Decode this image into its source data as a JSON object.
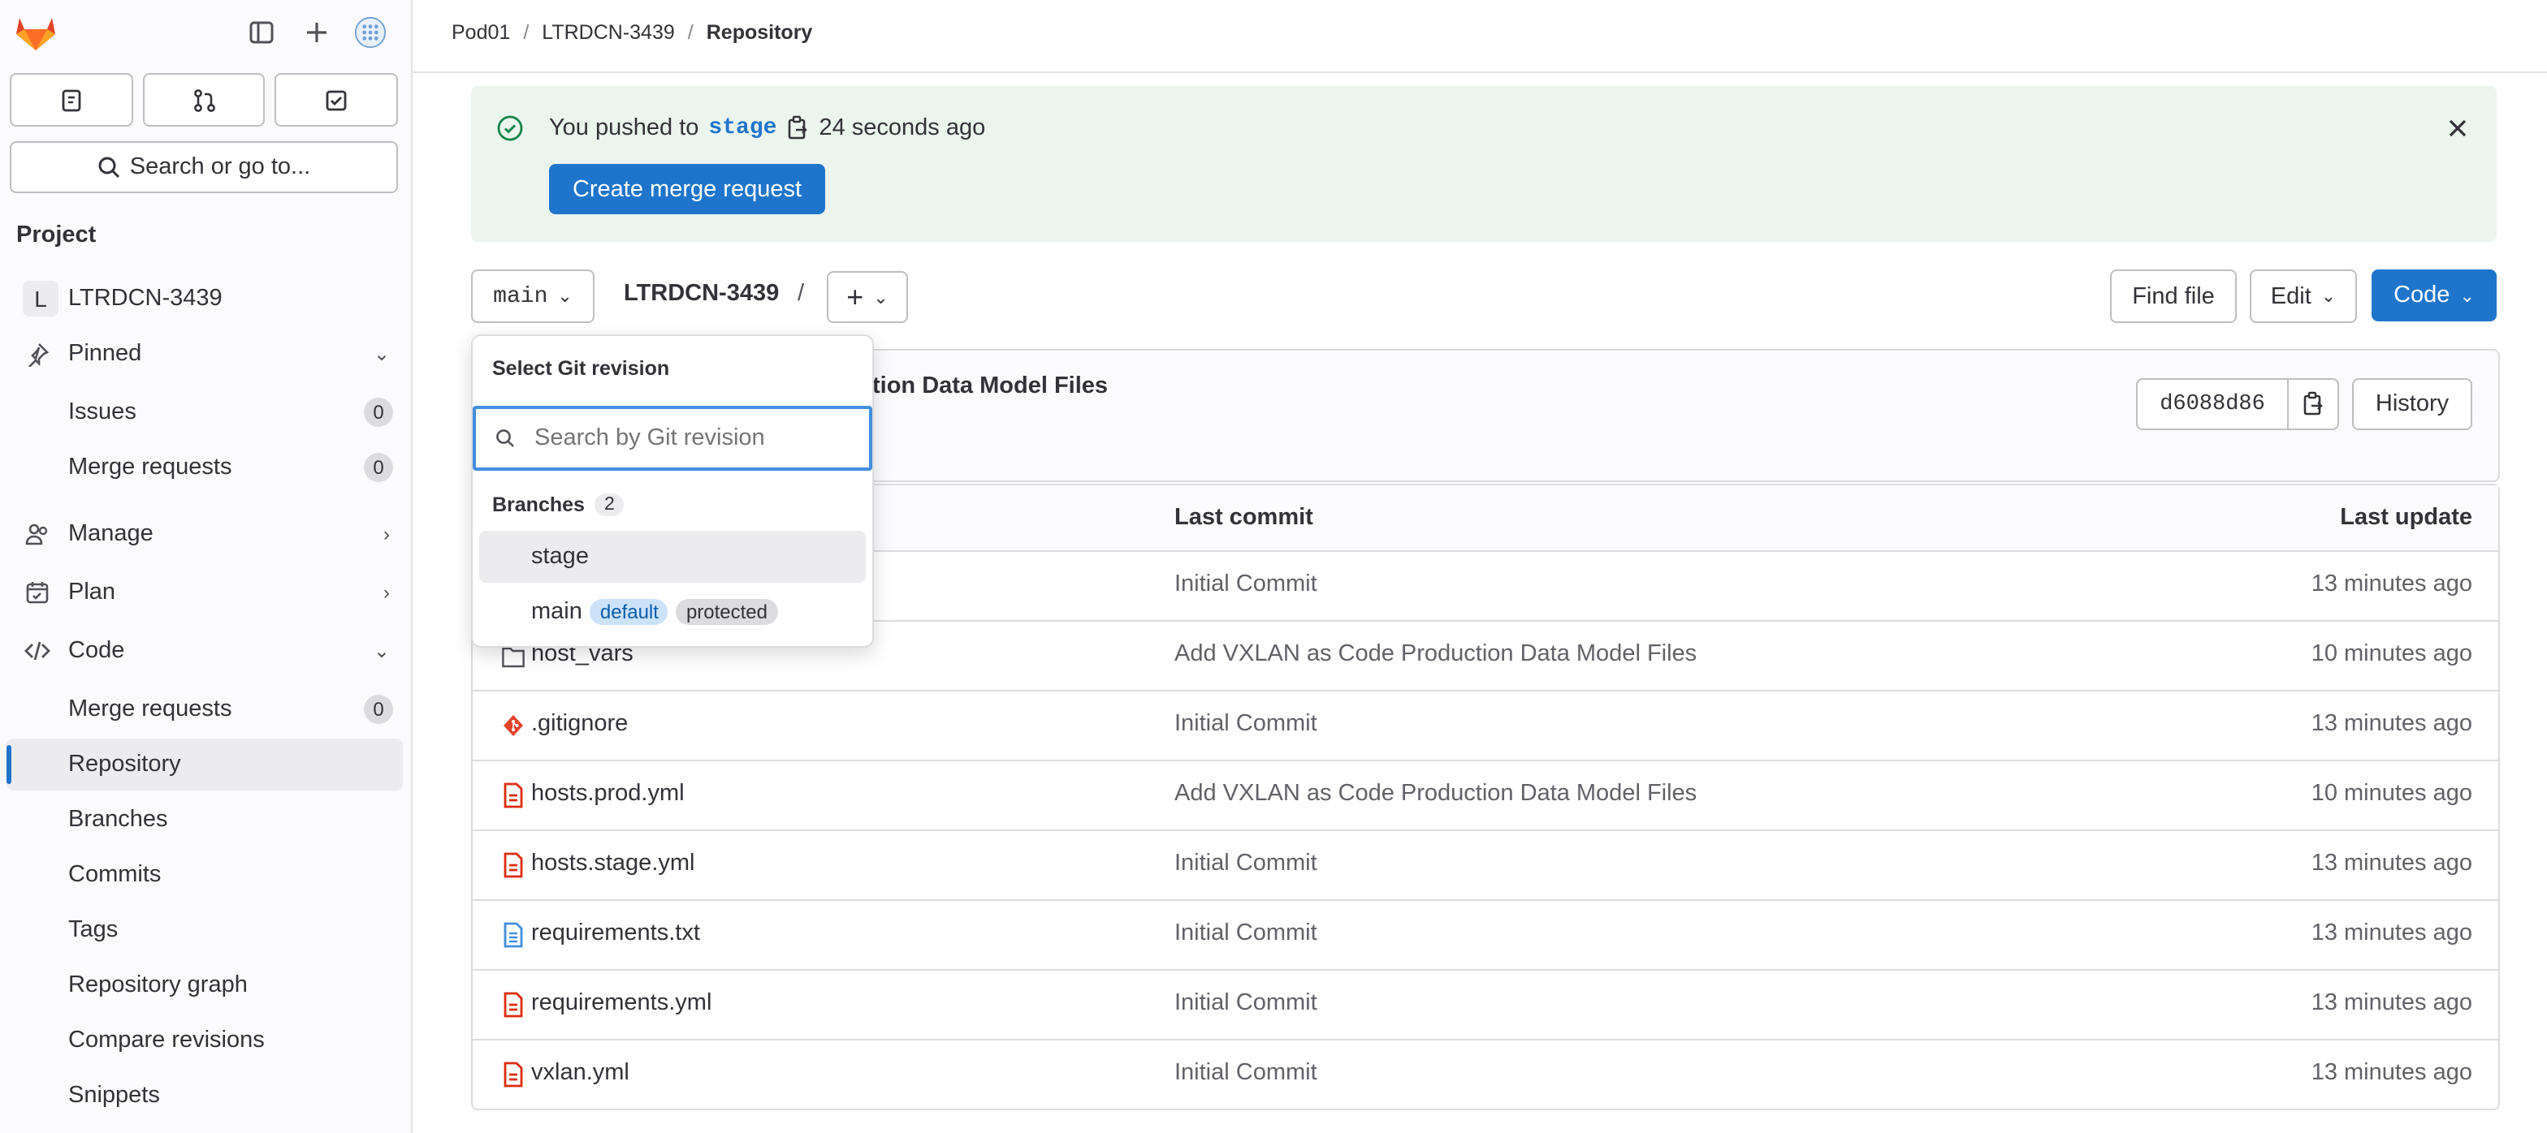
{
  "sidebar": {
    "search_label": "Search or go to...",
    "section_title": "Project",
    "project_initial": "L",
    "project_name": "LTRDCN-3439",
    "pinned": "Pinned",
    "issues": "Issues",
    "issues_count": "0",
    "merge_requests": "Merge requests",
    "merge_requests_count": "0",
    "manage": "Manage",
    "plan": "Plan",
    "code": "Code",
    "code_items": {
      "merge_requests": "Merge requests",
      "merge_requests_count": "0",
      "repository": "Repository",
      "branches": "Branches",
      "commits": "Commits",
      "tags": "Tags",
      "repository_graph": "Repository graph",
      "compare_revisions": "Compare revisions",
      "snippets": "Snippets"
    }
  },
  "breadcrumb": {
    "group": "Pod01",
    "project": "LTRDCN-3439",
    "current": "Repository",
    "separator": "/"
  },
  "alert": {
    "prefix": "You pushed to",
    "branch": "stage",
    "time": "24 seconds ago",
    "button": "Create merge request"
  },
  "toolbar": {
    "branch": "main",
    "path_name": "LTRDCN-3439",
    "path_sep": "/",
    "add_label": "+",
    "find_file": "Find file",
    "edit": "Edit",
    "code": "Code"
  },
  "commit": {
    "title": "tion Data Model Files",
    "sha": "d6088d86",
    "history": "History"
  },
  "table": {
    "headers": {
      "last_commit": "Last commit",
      "last_update": "Last update"
    },
    "rows": [
      {
        "name": "",
        "commit": "Initial Commit",
        "time": "13 minutes ago"
      },
      {
        "name": "host_vars",
        "commit": "Add VXLAN as Code Production Data Model Files",
        "time": "10 minutes ago"
      },
      {
        "name": ".gitignore",
        "commit": "Initial Commit",
        "time": "13 minutes ago"
      },
      {
        "name": "hosts.prod.yml",
        "commit": "Add VXLAN as Code Production Data Model Files",
        "time": "10 minutes ago"
      },
      {
        "name": "hosts.stage.yml",
        "commit": "Initial Commit",
        "time": "13 minutes ago"
      },
      {
        "name": "requirements.txt",
        "commit": "Initial Commit",
        "time": "13 minutes ago"
      },
      {
        "name": "requirements.yml",
        "commit": "Initial Commit",
        "time": "13 minutes ago"
      },
      {
        "name": "vxlan.yml",
        "commit": "Initial Commit",
        "time": "13 minutes ago"
      }
    ]
  },
  "dropdown": {
    "title": "Select Git revision",
    "placeholder": "Search by Git revision",
    "branches_header": "Branches",
    "branches_count": "2",
    "items": [
      {
        "name": "stage"
      },
      {
        "name": "main",
        "tags": [
          "default",
          "protected"
        ]
      }
    ]
  },
  "colors": {
    "accent": "#1f75cb",
    "alert_bg": "#ecf4ee",
    "success": "#108548",
    "file_red": "#dd2b0e"
  }
}
